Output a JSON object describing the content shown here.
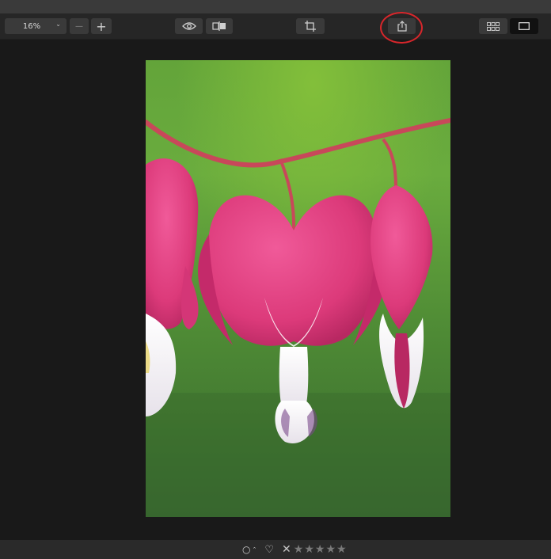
{
  "toolbar": {
    "zoom": {
      "value": "16%",
      "options_caret": "⌄"
    },
    "zoom_out_label": "—",
    "zoom_in_label": "+",
    "icons": {
      "preview": "eye-icon",
      "compare": "split-compare-icon",
      "crop": "crop-icon",
      "share": "share-icon",
      "grid_view": "grid-icon",
      "single_view": "single-view-icon"
    }
  },
  "annotation": {
    "color": "#d8262b"
  },
  "photo": {
    "subject": "bleeding-heart-flowers",
    "colors": {
      "background": "#5c9a35",
      "petal": "#e0407e",
      "white": "#f3f3f3",
      "stem": "#c84a5a"
    }
  },
  "bottombar": {
    "label_icon": "○",
    "label_caret": "⌃",
    "favorite_icon": "♡",
    "reject_icon": "✕",
    "stars": [
      "★",
      "★",
      "★",
      "★",
      "★"
    ]
  }
}
